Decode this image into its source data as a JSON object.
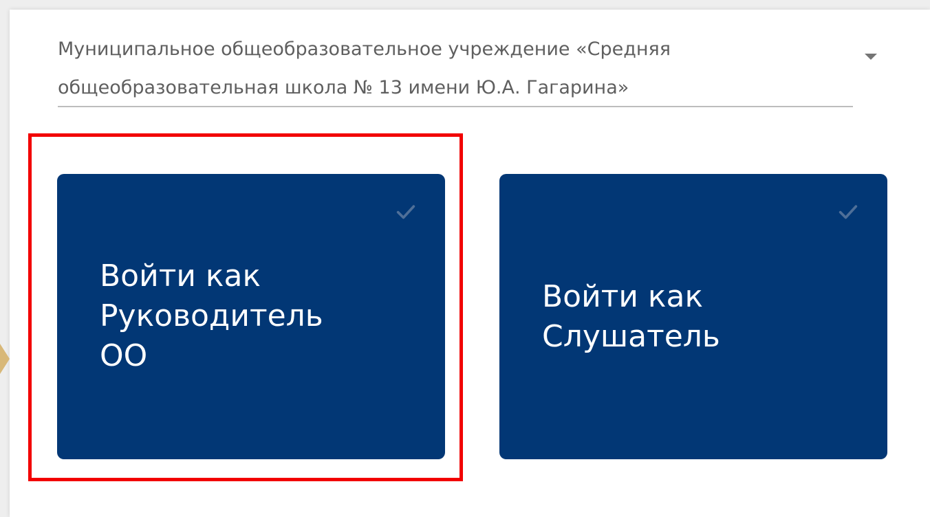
{
  "org_select": {
    "line1": "Муниципальное общеобразовательное учреждение «Средняя",
    "line2": "общеобразовательная школа № 13 имени Ю.А. Гагарина»",
    "icon": "caret-down-icon"
  },
  "cards": [
    {
      "lines": [
        "Войти как",
        "Руководитель",
        "ОО"
      ],
      "icon": "checkmark-icon",
      "highlighted": true
    },
    {
      "lines": [
        "Войти как",
        "Слушатель"
      ],
      "icon": "checkmark-icon",
      "highlighted": false
    }
  ],
  "colors": {
    "card_bg": "#023775",
    "highlight": "#f20000",
    "select_text": "#5f5f5f",
    "check": "#4f6f98"
  }
}
